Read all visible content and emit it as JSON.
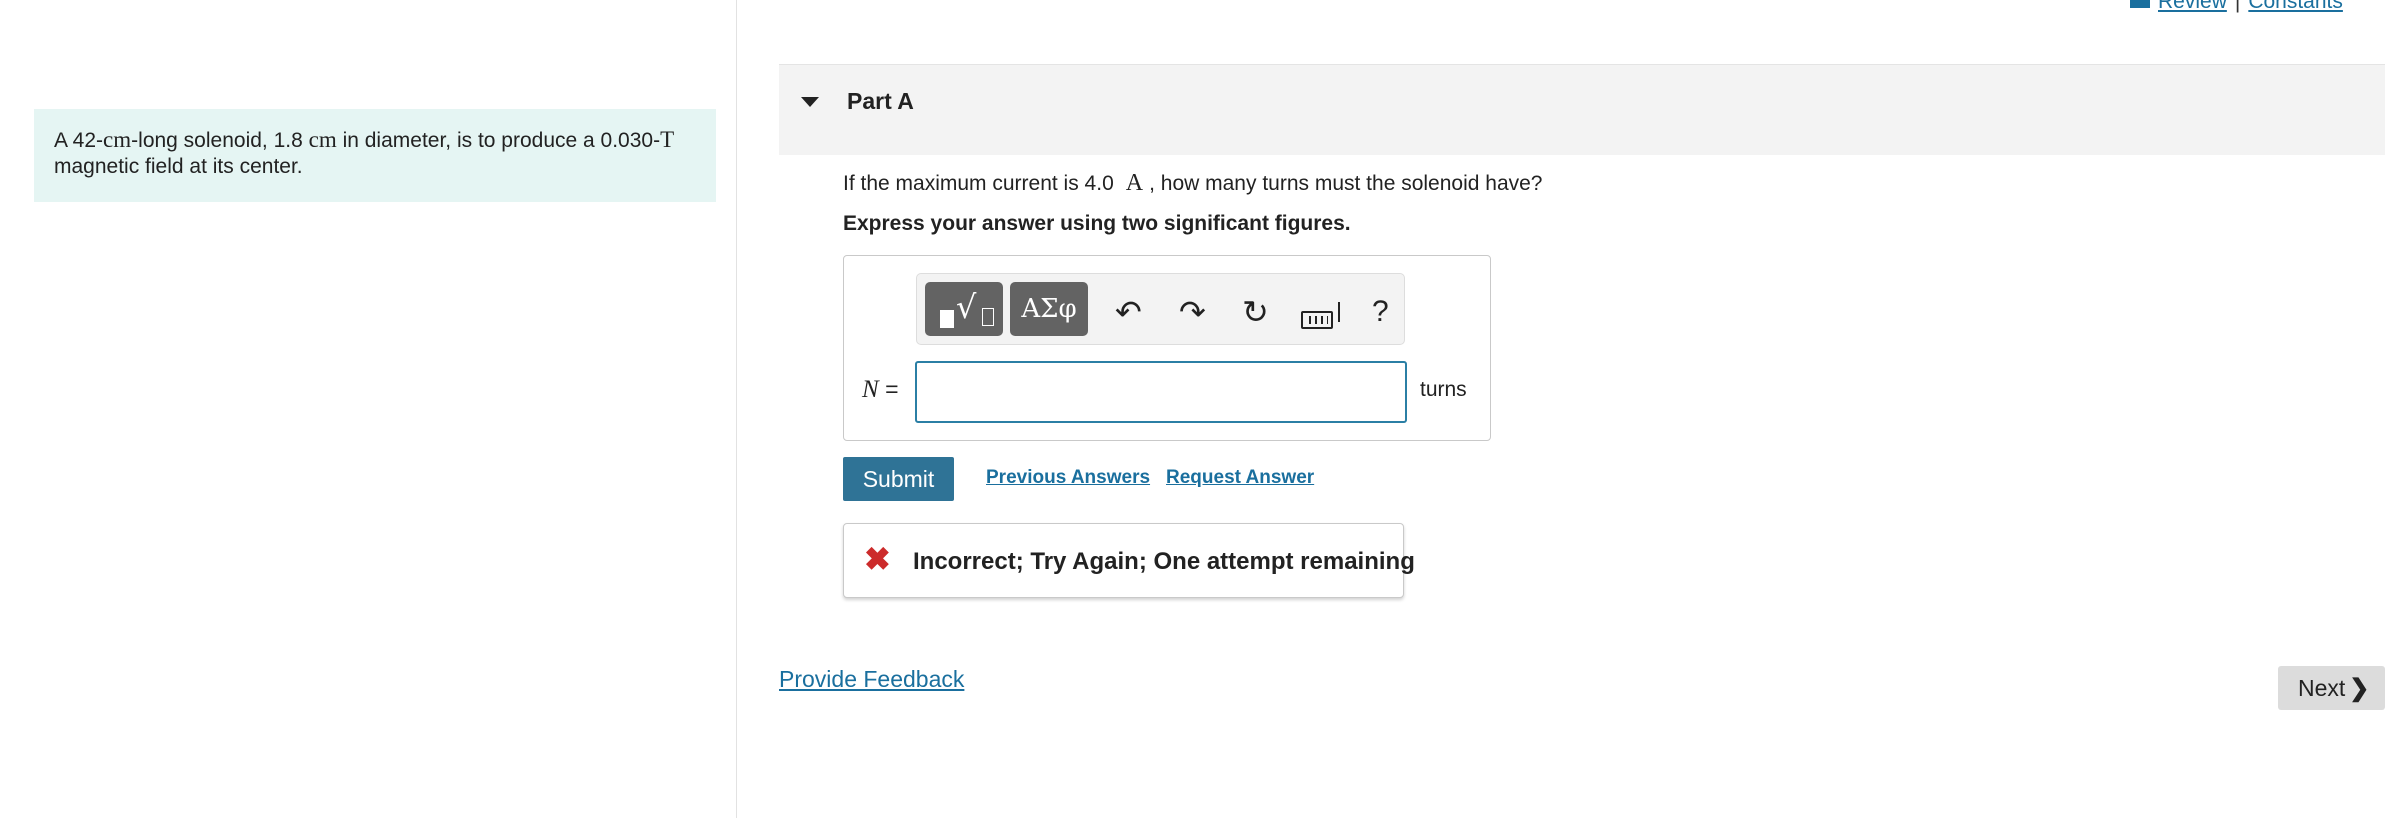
{
  "problem": {
    "prefix": "A 42-",
    "unit_cm_1": "cm",
    "part2": "-long solenoid, 1.8 ",
    "unit_cm_2": "cm",
    "part3": " in diameter, is to produce a 0.030-",
    "unit_T": "T",
    "part4": "magnetic field at its center."
  },
  "top_links": {
    "review": "Review",
    "separator": "|",
    "constants": "Constants"
  },
  "part": {
    "title": "Part A"
  },
  "question": {
    "text_before": "If the maximum current is 4.0",
    "unit": "A",
    "text_after": ", how many turns must the solenoid have?",
    "instruction": "Express your answer using two significant figures."
  },
  "toolbar": {
    "symbols_label": "ΑΣφ",
    "undo_icon": "↶",
    "redo_icon": "↷",
    "reset_icon": "↻",
    "help_label": "?"
  },
  "answer": {
    "variable": "N",
    "equals": "=",
    "value": "",
    "unit": "turns"
  },
  "actions": {
    "submit": "Submit",
    "previous_answers": "Previous Answers",
    "request_answer": "Request Answer"
  },
  "feedback": {
    "icon": "✖",
    "message": "Incorrect; Try Again; One attempt remaining"
  },
  "footer": {
    "provide_feedback": "Provide Feedback",
    "next": "Next",
    "next_chevron": "❯"
  },
  "colors": {
    "accent": "#2f7396",
    "link": "#1a6f9e",
    "error": "#cc2b2b",
    "problem_bg": "#e5f5f3"
  }
}
